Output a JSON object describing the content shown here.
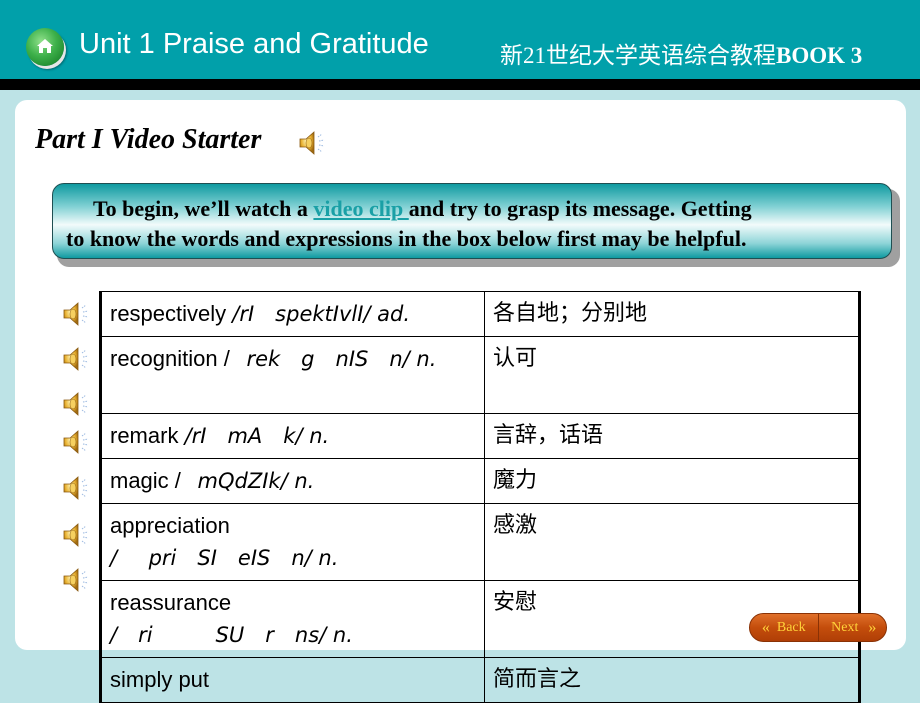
{
  "header": {
    "unit_title": "Unit 1 Praise and Gratitude",
    "book_title_cn": "新21世纪大学英语综合教程",
    "book_title_en": "BOOK 3",
    "home_icon": "home-icon"
  },
  "section": {
    "title": "Part I  Video Starter",
    "audio_icon": "speaker-icon"
  },
  "intro": {
    "line1_before": "To begin, we’ll watch a ",
    "link_text": "video clip ",
    "line1_after": "and try to grasp its message. Getting",
    "line2": "to know the words and expressions in the box below first may be helpful."
  },
  "vocabulary": [
    {
      "word": "respectively ",
      "phonetic": "/rI  spektIvlI/ ad.",
      "meaning": "各自地；分别地"
    },
    {
      "word": "recognition / ",
      "phonetic": " rek  g  nIS  n/ n.",
      "meaning": "认可"
    },
    {
      "word": "remark ",
      "phonetic": "/rI  mA  k/ n.",
      "meaning": "言辞，话语"
    },
    {
      "word": "magic / ",
      "phonetic": " mQdZIk/ n.",
      "meaning": "魔力"
    },
    {
      "word": "appreciation",
      "phonetic": "/   pri  SI  eIS  n/ n.",
      "meaning": "感激"
    },
    {
      "word": "reassurance",
      "phonetic": "/  ri      SU  r  ns/ n.",
      "meaning": "安慰"
    },
    {
      "word": "simply put",
      "phonetic": "",
      "meaning": "简而言之"
    }
  ],
  "navigation": {
    "back_label": "Back",
    "next_label": "Next",
    "back_icon": "«",
    "next_icon": "»"
  },
  "colors": {
    "header_bg": "#01a0aa",
    "page_bg": "#bde3e6",
    "link": "#1aa0a6",
    "nav_button": "#c44d0c",
    "nav_text": "#ffd23a"
  }
}
